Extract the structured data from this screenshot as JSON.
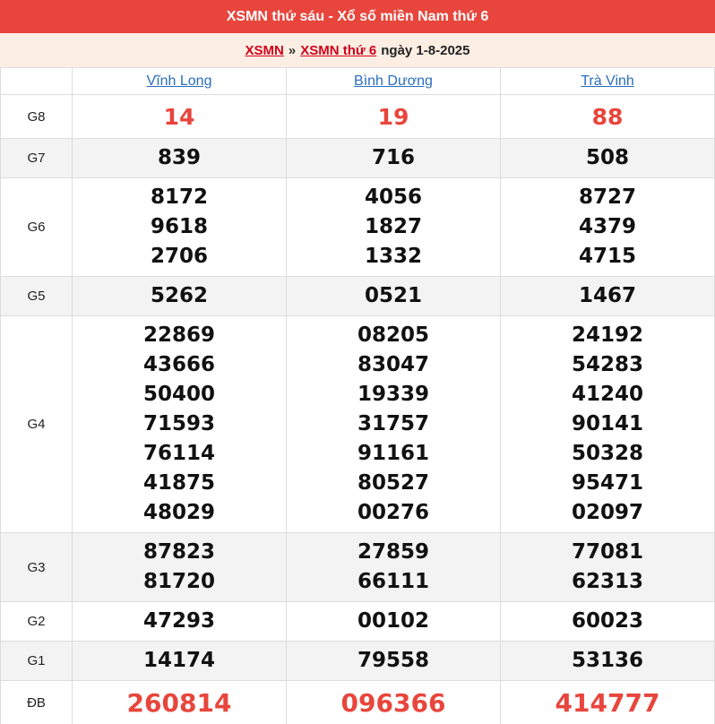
{
  "header": {
    "title": "XSMN thứ sáu - Xổ số miền Nam thứ 6"
  },
  "breadcrumb": {
    "link1": "XSMN",
    "separator": "»",
    "link2": "XSMN thứ 6",
    "date_text": "ngày 1-8-2025"
  },
  "colors": {
    "title_bg": "#e8453c",
    "crumb_bg": "#fdeee3",
    "link_red": "#d0021b",
    "link_blue": "#2a6ebb",
    "prize_red": "#e8453c"
  },
  "provinces": [
    "Vĩnh Long",
    "Bình Dương",
    "Trà Vinh"
  ],
  "rows": [
    {
      "label": "G8",
      "cells": [
        [
          "14"
        ],
        [
          "19"
        ],
        [
          "88"
        ]
      ]
    },
    {
      "label": "G7",
      "cells": [
        [
          "839"
        ],
        [
          "716"
        ],
        [
          "508"
        ]
      ]
    },
    {
      "label": "G6",
      "cells": [
        [
          "8172",
          "9618",
          "2706"
        ],
        [
          "4056",
          "1827",
          "1332"
        ],
        [
          "8727",
          "4379",
          "4715"
        ]
      ]
    },
    {
      "label": "G5",
      "cells": [
        [
          "5262"
        ],
        [
          "0521"
        ],
        [
          "1467"
        ]
      ]
    },
    {
      "label": "G4",
      "cells": [
        [
          "22869",
          "43666",
          "50400",
          "71593",
          "76114",
          "41875",
          "48029"
        ],
        [
          "08205",
          "83047",
          "19339",
          "31757",
          "91161",
          "80527",
          "00276"
        ],
        [
          "24192",
          "54283",
          "41240",
          "90141",
          "50328",
          "95471",
          "02097"
        ]
      ]
    },
    {
      "label": "G3",
      "cells": [
        [
          "87823",
          "81720"
        ],
        [
          "27859",
          "66111"
        ],
        [
          "77081",
          "62313"
        ]
      ]
    },
    {
      "label": "G2",
      "cells": [
        [
          "47293"
        ],
        [
          "00102"
        ],
        [
          "60023"
        ]
      ]
    },
    {
      "label": "G1",
      "cells": [
        [
          "14174"
        ],
        [
          "79558"
        ],
        [
          "53136"
        ]
      ]
    },
    {
      "label": "ĐB",
      "cells": [
        [
          "260814"
        ],
        [
          "096366"
        ],
        [
          "414777"
        ]
      ]
    }
  ]
}
